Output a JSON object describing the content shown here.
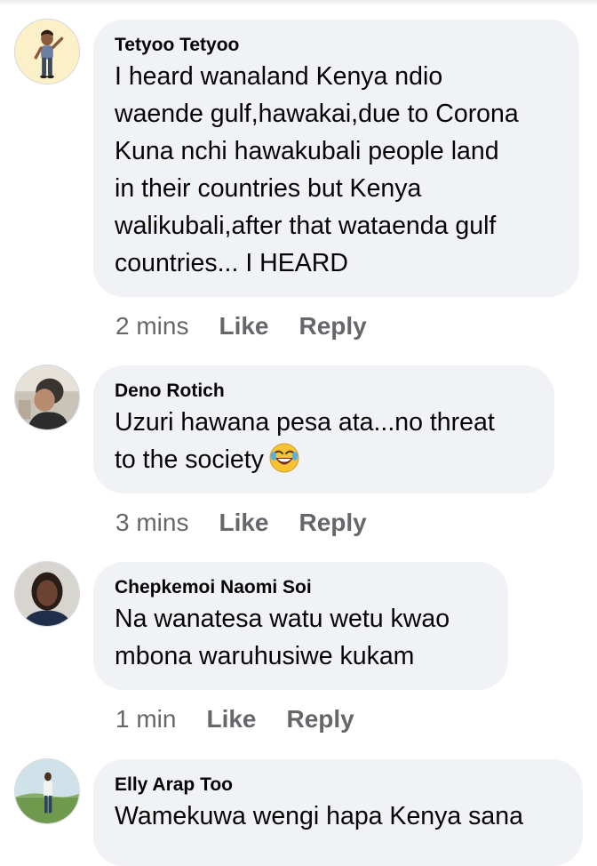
{
  "comments": [
    {
      "author": "Tetyoo Tetyoo",
      "avatar_icon": "bitmoji-avatar-icon",
      "lines": [
        "I heard wanaland Kenya ndio",
        "waende gulf,hawakai,due to Corona",
        "Kuna nchi hawakubali people land",
        "in their countries but Kenya",
        "walikubali,after that wataenda gulf",
        "countries... I HEARD"
      ],
      "time": "2 mins",
      "like_label": "Like",
      "reply_label": "Reply"
    },
    {
      "author": "Deno Rotich",
      "avatar_icon": "profile-photo-icon",
      "lines": [
        "Uzuri hawana pesa ata...no threat",
        "to the society"
      ],
      "emoji": "laughing-crying-emoji-icon",
      "time": "3 mins",
      "like_label": "Like",
      "reply_label": "Reply"
    },
    {
      "author": "Chepkemoi Naomi Soi",
      "avatar_icon": "profile-photo-icon",
      "lines": [
        "Na wanatesa watu wetu kwao",
        "mbona waruhusiwe kukam"
      ],
      "time": "1 min",
      "like_label": "Like",
      "reply_label": "Reply"
    },
    {
      "author": "Elly Arap Too",
      "avatar_icon": "profile-photo-icon",
      "lines": [
        "Wamekuwa wengi hapa Kenya sana"
      ]
    }
  ],
  "colors": {
    "bubble_bg": "#f0f2f5",
    "meta_text": "#65676b",
    "body_text": "#050505"
  }
}
